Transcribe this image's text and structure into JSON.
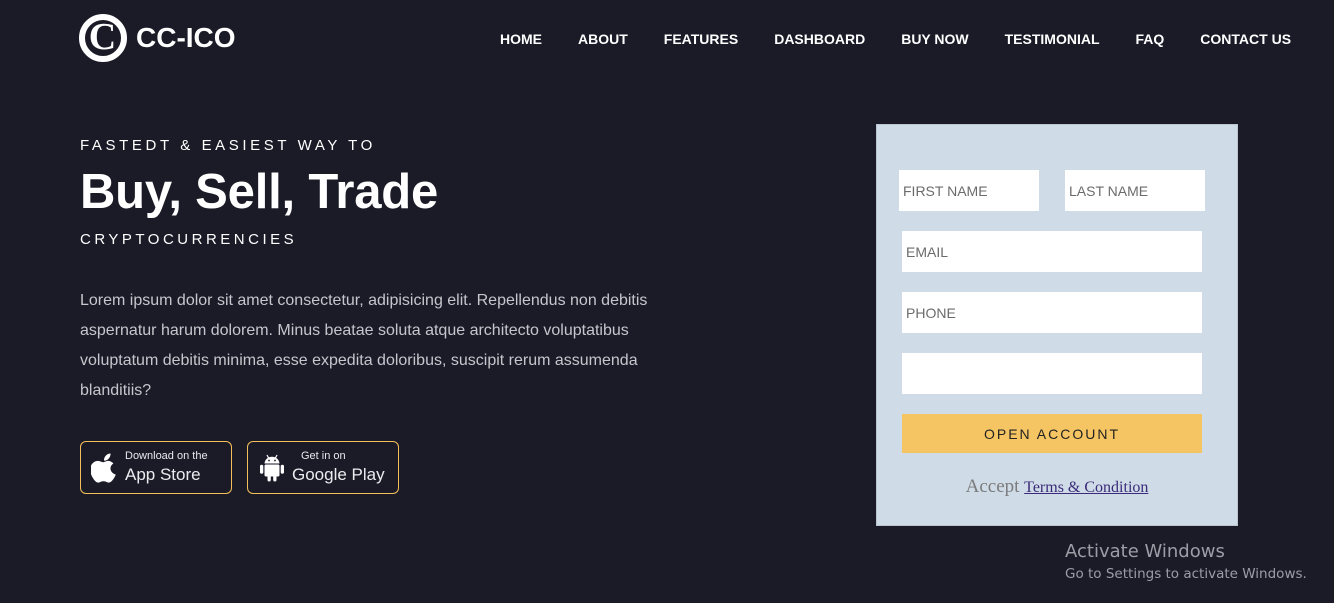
{
  "brand": {
    "name": "CC-ICO",
    "mark": "C"
  },
  "nav": {
    "items": [
      "HOME",
      "ABOUT",
      "FEATURES",
      "DASHBOARD",
      "BUY NOW",
      "TESTIMONIAL",
      "FAQ",
      "CONTACT US"
    ]
  },
  "hero": {
    "eyebrow": "FASTEDT & EASIEST WAY TO",
    "headline": "Buy, Sell, Trade",
    "sub": "CRYPTOCURRENCIES",
    "paragraph": "Lorem ipsum dolor sit amet consectetur, adipisicing elit. Repellendus non debitis aspernatur harum dolorem. Minus beatae soluta atque architecto voluptatibus voluptatum debitis minima, esse expedita doloribus, suscipit rerum assumenda blanditiis?"
  },
  "store": {
    "app": {
      "small": "Download on the",
      "big": "App Store",
      "icon": "apple-icon"
    },
    "play": {
      "small": "Get in on",
      "big": "Google Play",
      "icon": "android-icon"
    }
  },
  "form": {
    "first_name_placeholder": "FIRST NAME",
    "last_name_placeholder": "LAST NAME",
    "email_placeholder": "EMAIL",
    "phone_placeholder": "PHONE",
    "extra_placeholder": "",
    "submit_label": "OPEN ACCOUNT",
    "accept_text": "Accept",
    "terms_link": "Terms & Condition"
  },
  "watermark": {
    "title": "Activate Windows",
    "subtitle": "Go to Settings to activate Windows."
  },
  "colors": {
    "background": "#1b1a27",
    "accent": "#f6c563",
    "form_bg": "#cfdce7"
  }
}
